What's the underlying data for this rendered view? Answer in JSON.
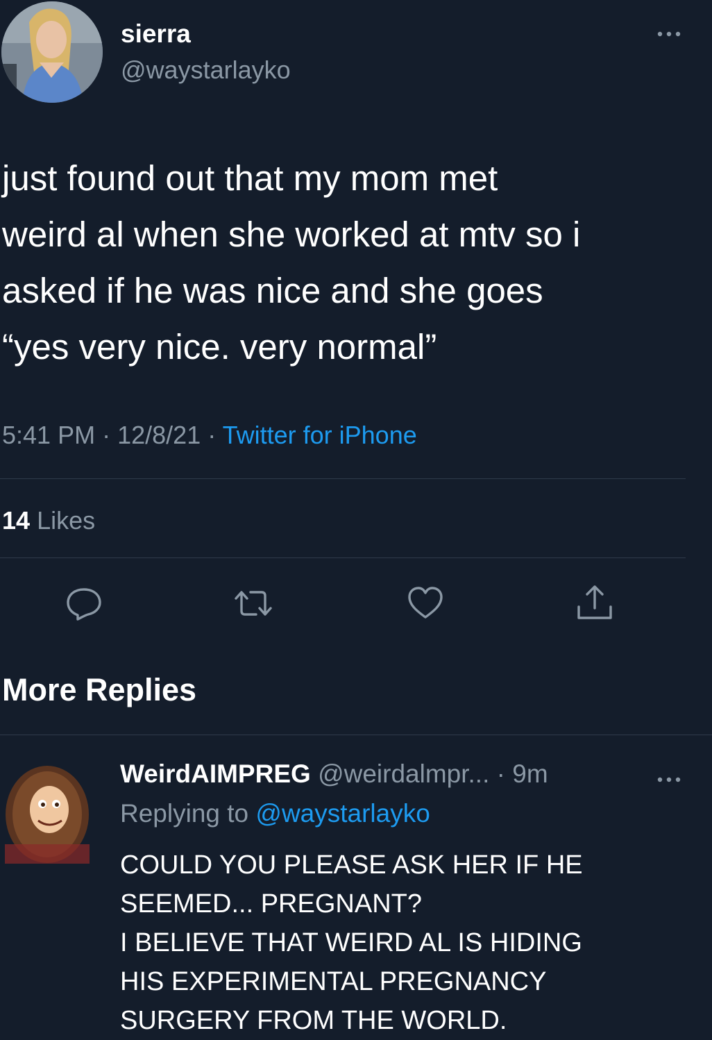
{
  "tweet": {
    "author": {
      "display_name": "sierra",
      "handle": "@waystarlayko"
    },
    "text_lines": [
      "just found out that my mom met",
      "weird al when she worked at mtv so i",
      "asked if he was nice and she goes",
      "“yes very nice. very normal”"
    ],
    "time": "5:41 PM",
    "date": "12/8/21",
    "separator": "·",
    "source": "Twitter for iPhone",
    "likes_count": "14",
    "likes_label": "Likes",
    "more_icon": "more-horizontal-icon"
  },
  "actions": [
    {
      "name": "reply",
      "icon": "reply-icon"
    },
    {
      "name": "retweet",
      "icon": "retweet-icon"
    },
    {
      "name": "like",
      "icon": "heart-icon"
    },
    {
      "name": "share",
      "icon": "share-icon"
    }
  ],
  "more_replies": {
    "title": "More Replies"
  },
  "reply": {
    "display_name": "WeirdAIMPREG",
    "handle": "@weirdalmpr...",
    "time": "· 9m",
    "replying_prefix": "Replying to",
    "replying_to": "@waystarlayko",
    "text_lines": [
      "COULD YOU PLEASE ASK HER IF HE",
      "SEEMED... PREGNANT?",
      "I BELIEVE THAT WEIRD AL IS HIDING",
      "HIS EXPERIMENTAL PREGNANCY",
      "SURGERY FROM THE WORLD."
    ]
  },
  "colors": {
    "background": "#141d2b",
    "text": "#ffffff",
    "secondary": "#8b98a5",
    "link": "#1d9bf0",
    "divider": "#2f3b4b"
  }
}
